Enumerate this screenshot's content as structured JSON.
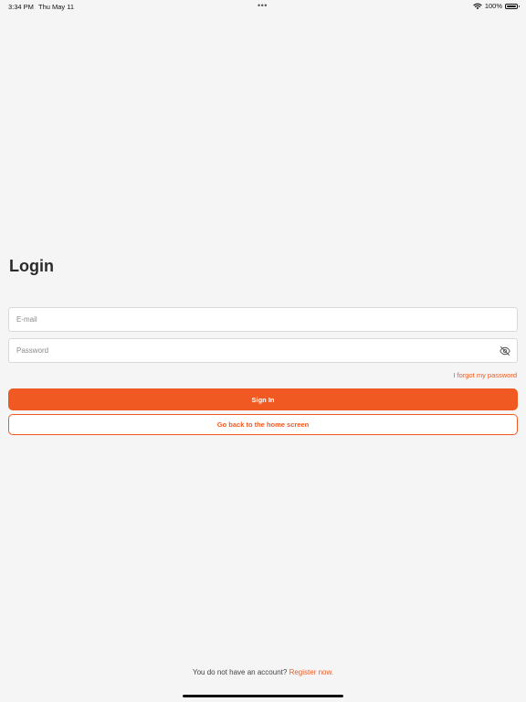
{
  "status_bar": {
    "time": "3:34 PM",
    "date": "Thu May 11",
    "dots": "•••",
    "battery": "100%",
    "wifi_icon": "wifi-icon",
    "battery_icon": "battery-icon"
  },
  "login": {
    "title": "Login",
    "email_placeholder": "E-mail",
    "email_value": "",
    "password_placeholder": "Password",
    "password_value": "",
    "eye_icon": "eye-off-icon",
    "forgot_password": "I forgot my password",
    "sign_in_label": "Sign In",
    "home_label": "Go back to the home screen"
  },
  "footer": {
    "no_account_text": "You do not have an account?",
    "register_label": "Register now."
  },
  "colors": {
    "accent": "#f05a22",
    "background": "#f5f5f5",
    "field_background": "#ffffff",
    "field_border": "#d9d9d9",
    "title": "#2b2b2b"
  }
}
